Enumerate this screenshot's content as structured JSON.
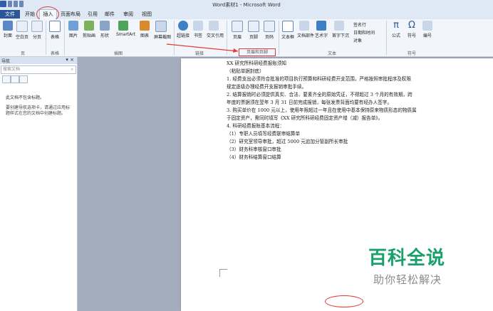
{
  "title": "Word素材1 - Microsoft Word",
  "tabs": [
    "文件",
    "开始",
    "插入",
    "页面布局",
    "引用",
    "邮件",
    "审阅",
    "视图"
  ],
  "ribbon": {
    "buttons": [
      "封面",
      "空白页",
      "分页",
      "表格",
      "图片",
      "剪贴画",
      "形状",
      "SmartArt",
      "图表",
      "屏幕截图",
      "超链接",
      "书签",
      "交叉引用",
      "页眉",
      "页脚",
      "页码",
      "文本框",
      "文档部件",
      "艺术字",
      "首字下沉",
      "公式",
      "符号",
      "编号"
    ],
    "small_buttons": [
      "签名行",
      "日期和时间",
      "对象"
    ],
    "groups": [
      "页",
      "表格",
      "插图",
      "链接",
      "页眉和页脚",
      "文本",
      "符号"
    ]
  },
  "nav": {
    "title": "导航",
    "search_placeholder": "搜索文档",
    "no_headings": "此文档不包含标题。",
    "hint": "要创建导航选项卡，请通过应用标题样式在您的文档中创建标题。"
  },
  "document": {
    "lines": [
      "XX 研究所科研经费报账须知",
      "（粘贴单据封底）",
      "1. 经费支出必须符合批准的项目执行预算和科研经费开支范围，严格按照审批程序及权限",
      "规定逐级办理经费开支报销审批手续。",
      "2. 结算报销时必须提供真实、合法、要素齐全的原始凭证，不得超过 3 个月的有效期，跨",
      "年度的票据须在翌年 3 月 31 日前完成报销，每张发票背面均要有经办人签字。",
      "3. 购买单价在 1000 元以上，使用年限超过一年且在使用中基本保持原来物质形态的物质属",
      "于固定资产，需同时填写《XX 研究所科研经费固定资产增（减）报告单》。",
      "4. 科研经费报账基本流程：",
      "（1）专职人员填写经费联审结算单",
      "（2）研究室领导审批，超过 5000 元追加分管副所长审批",
      "（3）财务科审核窗口审批",
      "（4）财务科结算窗口结算"
    ]
  },
  "watermark": {
    "main": "百科全说",
    "sub": "助你轻松解决"
  },
  "colors": {
    "file_tab": "#2b5797",
    "annotation": "#e23b32",
    "watermark_green": "#1aa06b"
  }
}
